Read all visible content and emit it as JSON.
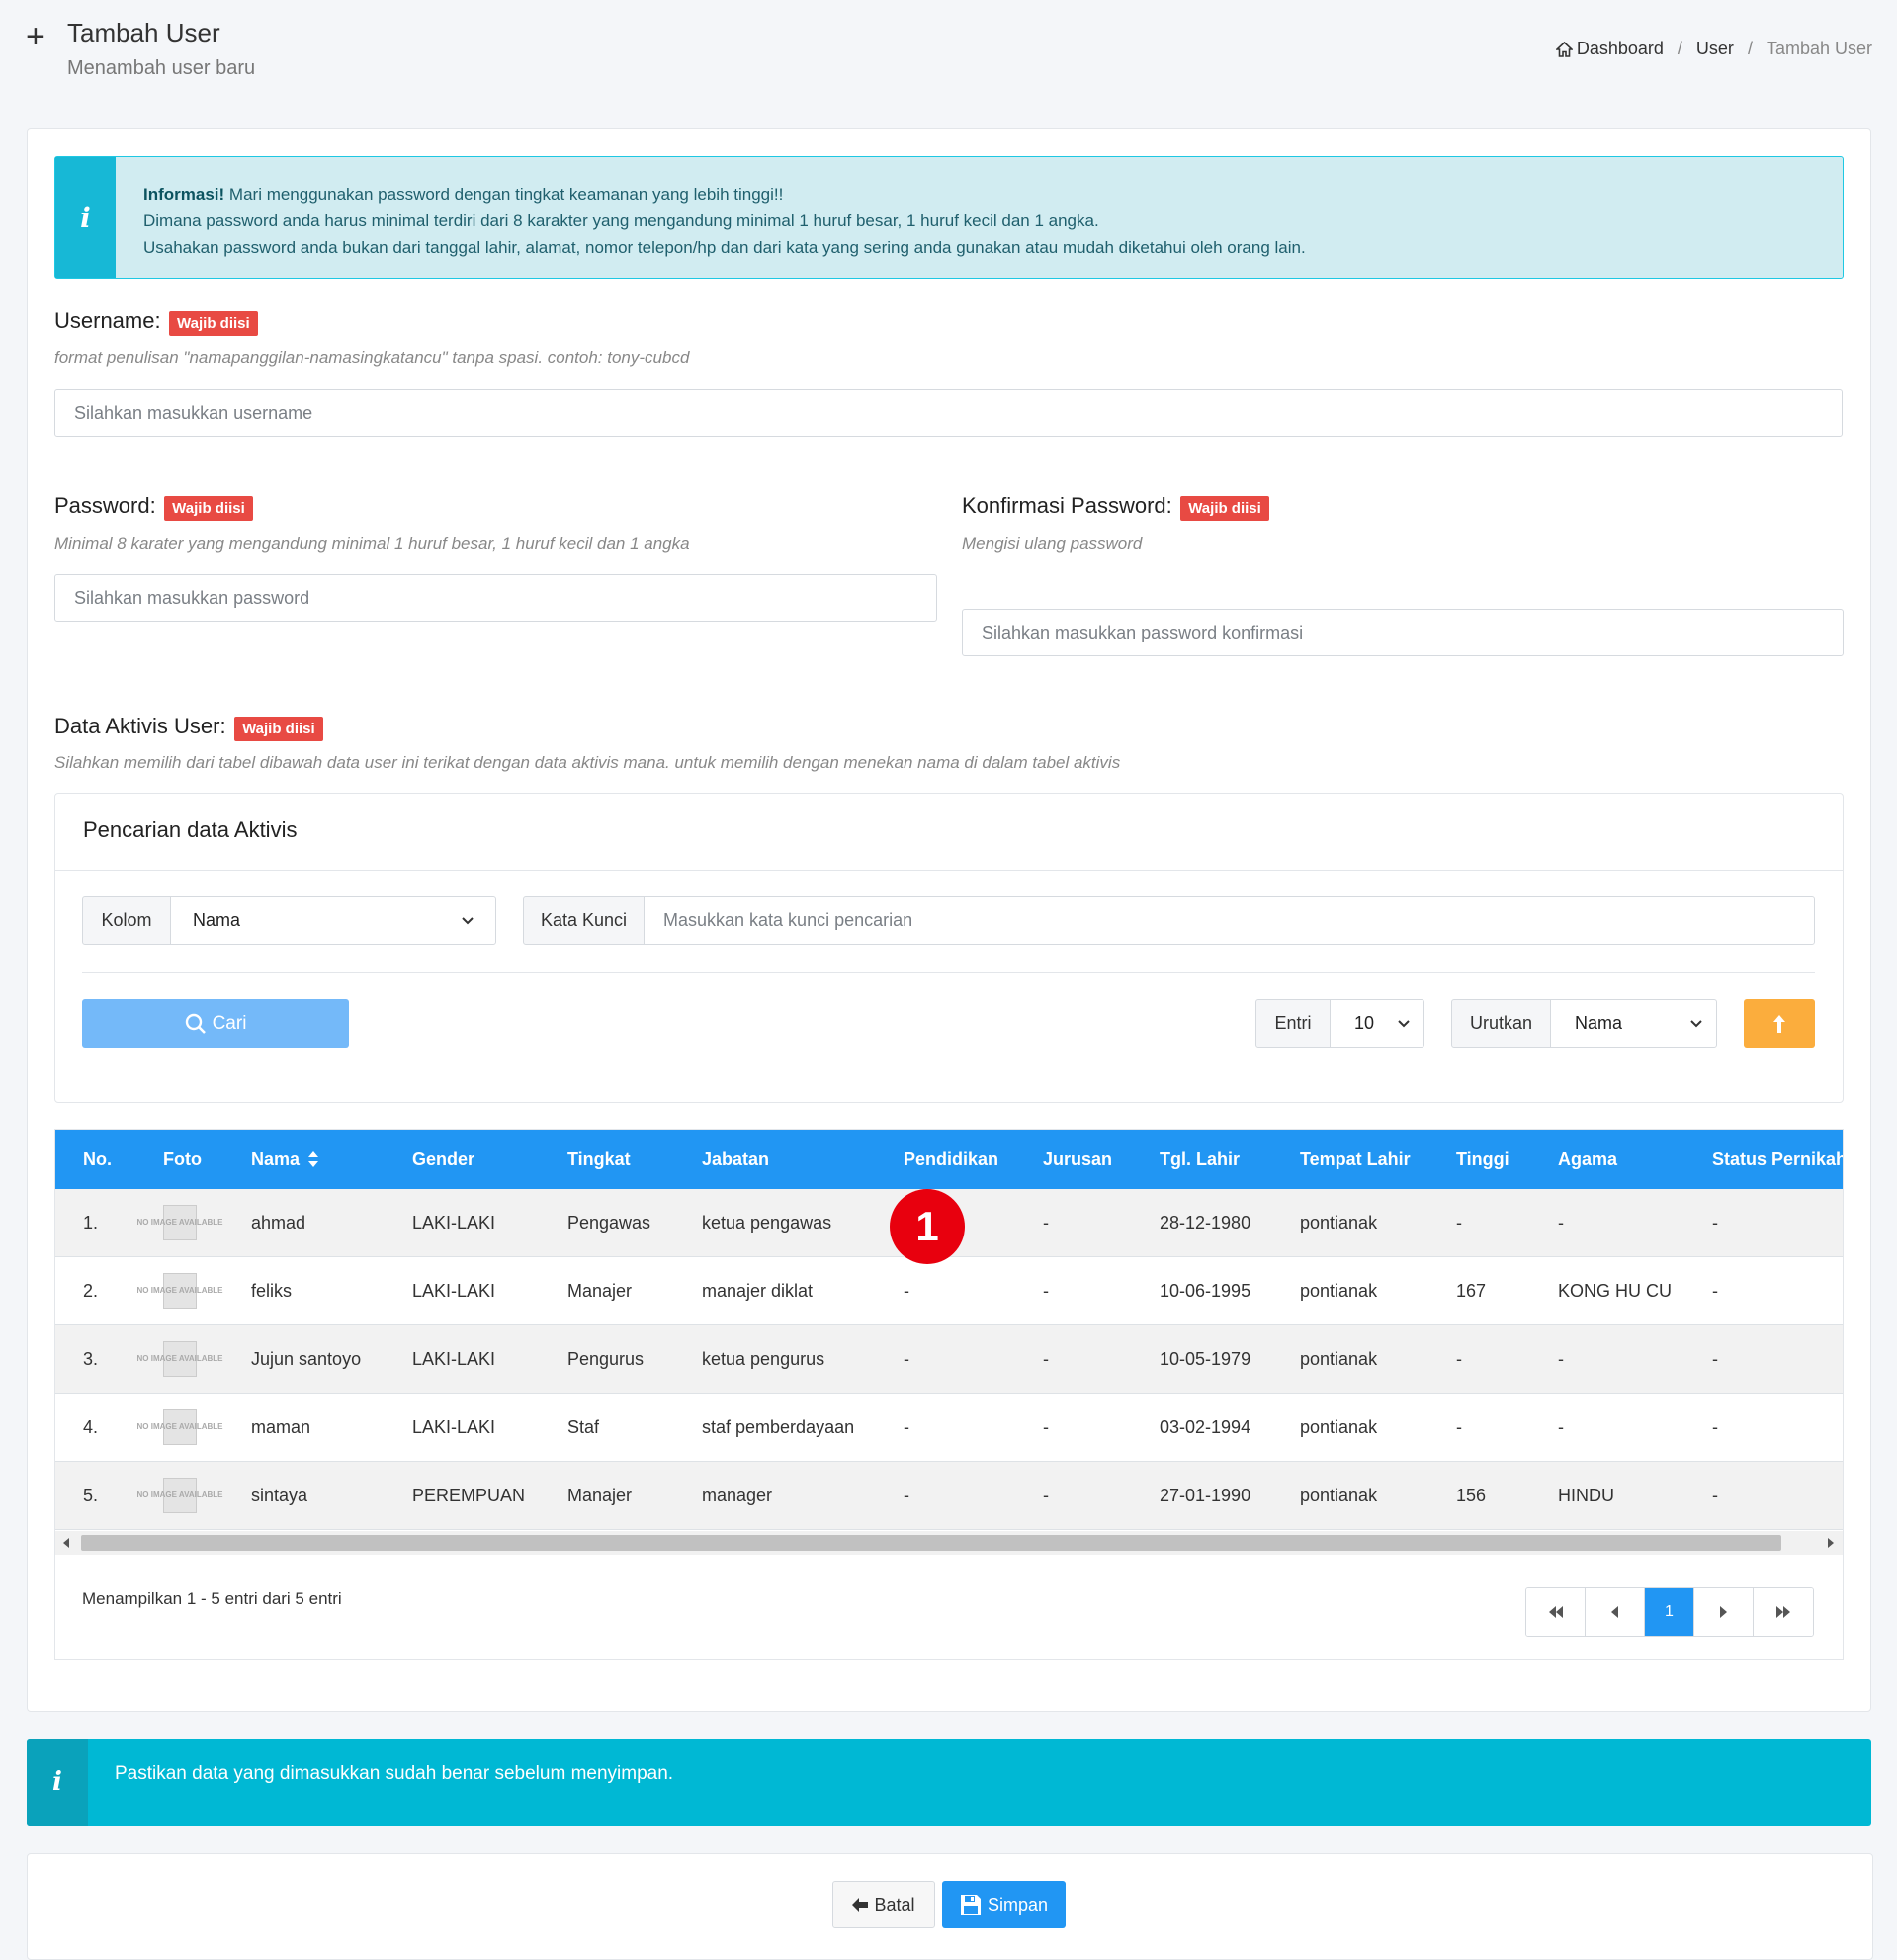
{
  "header": {
    "plus": "+",
    "title": "Tambah User",
    "subtitle": "Menambah user baru"
  },
  "breadcrumb": {
    "items": [
      "Dashboard",
      "User",
      "Tambah User"
    ],
    "sep": "/"
  },
  "info": {
    "icon": "i",
    "strong": "Informasi!",
    "line1": " Mari menggunakan password dengan tingkat keamanan yang lebih tinggi!!",
    "line2": "Dimana password anda harus minimal terdiri dari 8 karakter yang mengandung minimal 1 huruf besar, 1 huruf kecil dan 1 angka.",
    "line3": "Usahakan password anda bukan dari tanggal lahir, alamat, nomor telepon/hp dan dari kata yang sering anda gunakan atau mudah diketahui oleh orang lain."
  },
  "required_badge": "Wajib diisi",
  "username": {
    "label": "Username:",
    "hint": "format penulisan \"namapanggilan-namasingkatancu\" tanpa spasi. contoh: tony-cubcd",
    "placeholder": "Silahkan masukkan username"
  },
  "password": {
    "label": "Password:",
    "hint": "Minimal 8 karater yang mengandung minimal 1 huruf besar, 1 huruf kecil dan 1 angka",
    "placeholder": "Silahkan masukkan password"
  },
  "confirm": {
    "label": "Konfirmasi Password:",
    "hint": "Mengisi ulang password",
    "placeholder": "Silahkan masukkan password konfirmasi"
  },
  "aktivis": {
    "label": "Data Aktivis User:",
    "hint": "Silahkan memilih dari tabel dibawah data user ini terikat dengan data aktivis mana. untuk memilih dengan menekan nama di dalam tabel aktivis"
  },
  "search": {
    "title": "Pencarian data Aktivis",
    "kolom_label": "Kolom",
    "kolom_value": "Nama",
    "kata_label": "Kata Kunci",
    "kata_placeholder": "Masukkan kata kunci pencarian",
    "cari_label": "Cari",
    "entri_label": "Entri",
    "entri_value": "10",
    "urutkan_label": "Urutkan",
    "urutkan_value": "Nama"
  },
  "table": {
    "headers": [
      "No.",
      "Foto",
      "Nama",
      "Gender",
      "Tingkat",
      "Jabatan",
      "Pendidikan",
      "Jurusan",
      "Tgl. Lahir",
      "Tempat Lahir",
      "Tinggi",
      "Agama",
      "Status Pernikahan"
    ],
    "rows": [
      [
        "1.",
        "",
        "ahmad",
        "LAKI-LAKI",
        "Pengawas",
        "ketua pengawas",
        "",
        "-",
        "28-12-1980",
        "pontianak",
        "-",
        "-",
        "-"
      ],
      [
        "2.",
        "",
        "feliks",
        "LAKI-LAKI",
        "Manajer",
        "manajer diklat",
        "-",
        "-",
        "10-06-1995",
        "pontianak",
        "167",
        "KONG HU CU",
        "-"
      ],
      [
        "3.",
        "",
        "Jujun santoyo",
        "LAKI-LAKI",
        "Pengurus",
        "ketua pengurus",
        "-",
        "-",
        "10-05-1979",
        "pontianak",
        "-",
        "-",
        "-"
      ],
      [
        "4.",
        "",
        "maman",
        "LAKI-LAKI",
        "Staf",
        "staf pemberdayaan",
        "-",
        "-",
        "03-02-1994",
        "pontianak",
        "-",
        "-",
        "-"
      ],
      [
        "5.",
        "",
        "sintaya",
        "PEREMPUAN",
        "Manajer",
        "manager",
        "-",
        "-",
        "27-01-1990",
        "pontianak",
        "156",
        "HINDU",
        "-"
      ]
    ],
    "noimage_text": "NO IMAGE AVAILABLE",
    "footer": "Menampilkan 1 - 5 entri dari 5 entri",
    "page": "1"
  },
  "marker": "1",
  "note": {
    "icon": "i",
    "text": "Pastikan data yang dimasukkan sudah benar sebelum menyimpan."
  },
  "actions": {
    "batal": "Batal",
    "simpan": "Simpan"
  },
  "colors": {
    "primary": "#2196f3",
    "danger": "#e84a43",
    "warning": "#fbad3d",
    "info": "#00b8d4"
  }
}
